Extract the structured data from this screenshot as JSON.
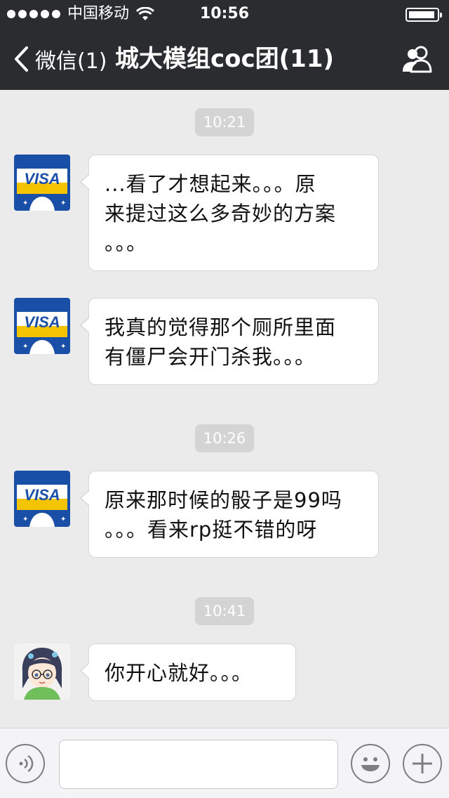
{
  "status_bar": {
    "carrier": "中国移动",
    "time": "10:56"
  },
  "nav": {
    "back_label": "微信(1)",
    "title": "城大模组coc团(11)"
  },
  "colors": {
    "bar_bg": "#2b2c30",
    "chat_bg": "#ebebeb",
    "timestamp_bg": "#d4d4d4",
    "visa_blue": "#1a4fa8",
    "visa_yellow": "#f5c400"
  },
  "chat": {
    "timestamps": [
      "10:21",
      "10:26",
      "10:41"
    ],
    "messages": [
      {
        "avatar": "visa-card-avatar",
        "text": "...看了才想起来。。。原\n来提过这么多奇妙的方案\n。。。"
      },
      {
        "avatar": "visa-card-avatar",
        "text": "我真的觉得那个厕所里面\n有僵尸会开门杀我。。。"
      },
      {
        "avatar": "visa-card-avatar",
        "text": "原来那时候的骰子是99吗\n。。。看来rp挺不错的呀"
      },
      {
        "avatar": "anime-girl-avatar",
        "text": "你开心就好。。。"
      }
    ],
    "avatar_logo_text": "VISA"
  },
  "input_bar": {
    "voice_icon": "voice-icon",
    "emoji_icon": "smiley-icon",
    "more_icon": "plus-icon",
    "input_value": ""
  }
}
